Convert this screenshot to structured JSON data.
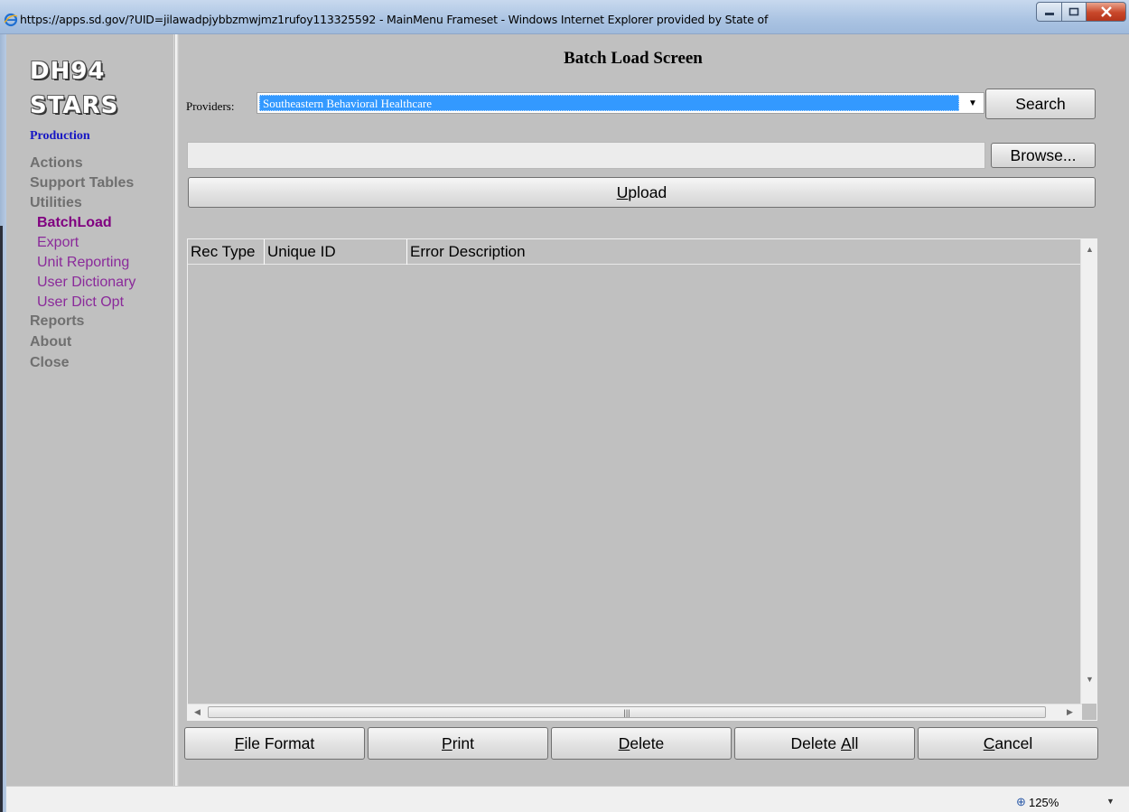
{
  "window": {
    "title": "https://apps.sd.gov/?UID=jilawadpjybbzmwjmz1rufoy113325592 - MainMenu Frameset - Windows Internet Explorer provided by State of"
  },
  "sidebar": {
    "logo_line1": "DH94",
    "logo_line2": "STARS",
    "environment": "Production",
    "nav": {
      "actions": "Actions",
      "support_tables": "Support Tables",
      "utilities": "Utilities",
      "utilities_items": {
        "batchload": "BatchLoad",
        "export": "Export",
        "unit_reporting": "Unit Reporting",
        "user_dictionary": "User Dictionary",
        "user_dict_opt": "User Dict Opt"
      },
      "reports": "Reports",
      "about": "About",
      "close": "Close"
    }
  },
  "main": {
    "title": "Batch Load Screen",
    "providers_label": "Providers:",
    "providers_selected": "Southeastern Behavioral Healthcare",
    "search_button": "Search",
    "file_path_value": "",
    "browse_button": "Browse...",
    "upload_button": {
      "mnemonic": "U",
      "rest": "pload"
    },
    "grid": {
      "columns": [
        "Rec Type",
        "Unique ID",
        "Error Description"
      ],
      "rows": []
    },
    "bottom_buttons": {
      "file_format": {
        "mnemonic": "F",
        "rest": "ile Format"
      },
      "print": {
        "mnemonic": "P",
        "rest": "rint"
      },
      "delete": {
        "mnemonic": "D",
        "rest": "elete"
      },
      "delete_all": {
        "before": "Delete ",
        "mnemonic": "A",
        "rest": "ll"
      },
      "cancel": {
        "mnemonic": "C",
        "rest": "ancel"
      }
    }
  },
  "statusbar": {
    "zoom": "125%"
  },
  "icons": {
    "browser": "ie-icon",
    "minimize": "minimize-icon",
    "maximize": "maximize-icon",
    "close": "close-icon",
    "dropdown": "chevron-down-icon",
    "zoom": "zoom-icon"
  },
  "colors": {
    "selection": "#3399ff",
    "environment_label": "#1717c4",
    "active_nav": "#800080",
    "sub_nav": "#8a2a9a",
    "close_button": "#c8472a"
  }
}
